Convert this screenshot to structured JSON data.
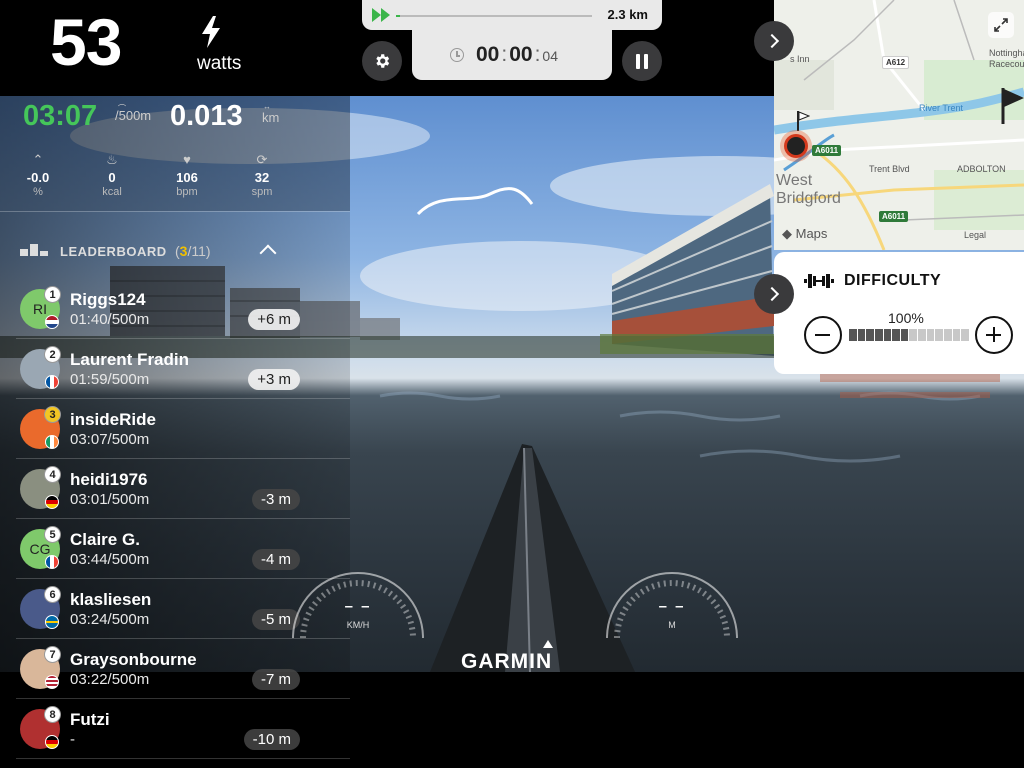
{
  "power": {
    "value": "53",
    "unit": "watts"
  },
  "progress": {
    "distance": "2.3 km",
    "fraction": 0.02
  },
  "timer": {
    "minutes": "00",
    "seconds": "00",
    "hundredths": "04",
    "colon": ":"
  },
  "stats": {
    "pace": "03:07",
    "pace_unit": "/500m",
    "distance": "0.013",
    "distance_unit": "km",
    "incline": {
      "value": "-0.0",
      "unit": "%"
    },
    "calories": {
      "value": "0",
      "unit": "kcal"
    },
    "heart_rate": {
      "value": "106",
      "unit": "bpm"
    },
    "stroke_rate": {
      "value": "32",
      "unit": "spm"
    }
  },
  "leaderboard": {
    "title": "LEADERBOARD",
    "count_open": "(",
    "current": "3",
    "total": "/11)",
    "entries": [
      {
        "rank": "1",
        "name": "Riggs124",
        "pace": "01:40/500m",
        "diff": "+6 m",
        "initials": "RI",
        "avatar_color": "#7fc96b",
        "flag": "NL"
      },
      {
        "rank": "2",
        "name": "Laurent Fradin",
        "pace": "01:59/500m",
        "diff": "+3 m",
        "initials": "",
        "avatar_color": "#9aa7b3",
        "flag": "FR"
      },
      {
        "rank": "3",
        "name": "insideRide",
        "pace": "03:07/500m",
        "diff": "",
        "initials": "",
        "avatar_color": "#ea6a2c",
        "flag": "IE"
      },
      {
        "rank": "4",
        "name": "heidi1976",
        "pace": "03:01/500m",
        "diff": "-3 m",
        "initials": "",
        "avatar_color": "#8a8f80",
        "flag": "DE"
      },
      {
        "rank": "5",
        "name": "Claire G.",
        "pace": "03:44/500m",
        "diff": "-4 m",
        "initials": "CG",
        "avatar_color": "#7fc96b",
        "flag": "FR"
      },
      {
        "rank": "6",
        "name": "klasliesen",
        "pace": "03:24/500m",
        "diff": "-5 m",
        "initials": "",
        "avatar_color": "#4a5a8a",
        "flag": "SE"
      },
      {
        "rank": "7",
        "name": "Graysonbourne",
        "pace": "03:22/500m",
        "diff": "-7 m",
        "initials": "",
        "avatar_color": "#d9b79a",
        "flag": "US"
      },
      {
        "rank": "8",
        "name": "Futzi",
        "pace": "-",
        "diff": "-10 m",
        "initials": "",
        "avatar_color": "#b03030",
        "flag": "DE"
      }
    ]
  },
  "map": {
    "labels": [
      "Nottingham",
      "Racecourse",
      "Trent Blvd",
      "ADBOLTON",
      "Legal"
    ],
    "place": "West Bridgford",
    "road_a612": "A612",
    "road_a6011": "A6011",
    "brand": "Maps",
    "river": "River Trent",
    "inn": "s Inn"
  },
  "difficulty": {
    "title": "DIFFICULTY",
    "value": "100%",
    "fraction": 0.5
  },
  "gauges": {
    "speed": {
      "value": "– –",
      "unit": "KM/H"
    },
    "distance": {
      "value": "– –",
      "unit": "M"
    }
  },
  "branding": "GARMIN",
  "colors": {
    "accent_green": "#45c65a",
    "gold": "#f3c623"
  }
}
